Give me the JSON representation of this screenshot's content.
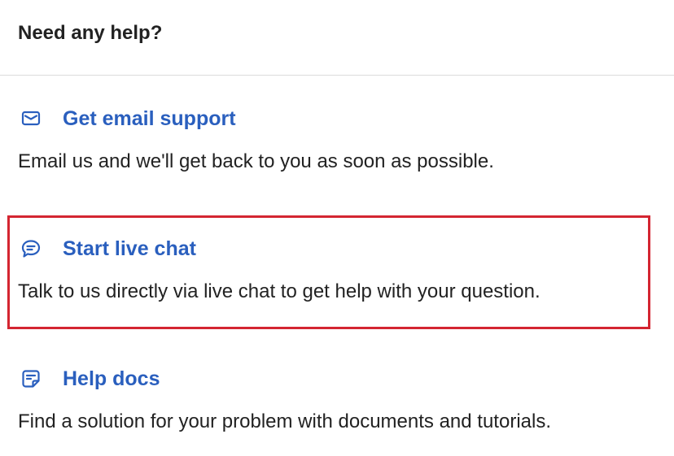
{
  "header": {
    "title": "Need any help?"
  },
  "options": [
    {
      "icon": "email-icon",
      "title": "Get email support",
      "description": "Email us and we'll get back to you as soon as possible."
    },
    {
      "icon": "chat-bubble-icon",
      "title": "Start live chat",
      "description": "Talk to us directly via live chat to get help with your question."
    },
    {
      "icon": "document-icon",
      "title": "Help docs",
      "description": "Find a solution for your problem with documents and tutorials."
    }
  ],
  "colors": {
    "link": "#2a5fbe",
    "text": "#222222",
    "divider": "#dcdcdc",
    "highlight": "#d42531"
  }
}
